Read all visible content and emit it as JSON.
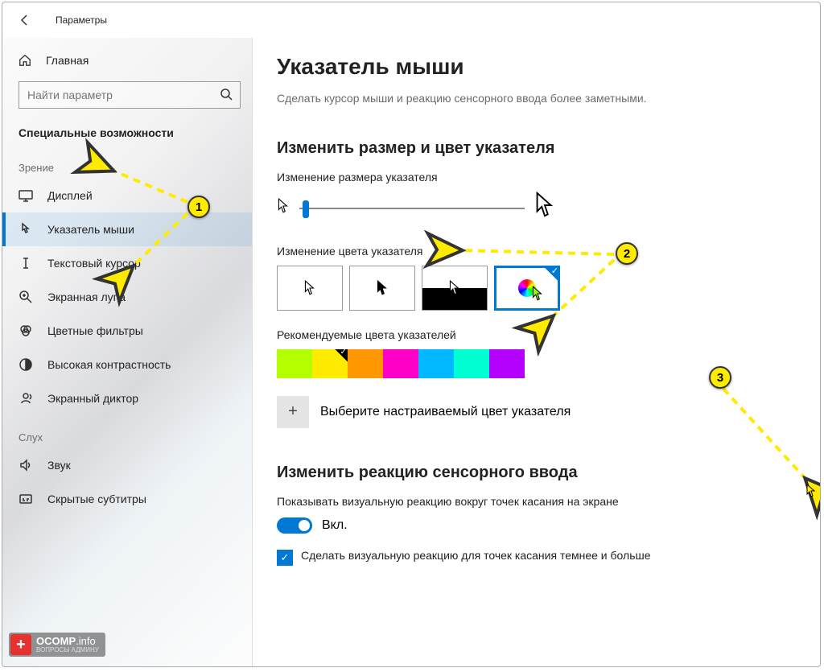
{
  "titlebar": {
    "title": "Параметры"
  },
  "sidebar": {
    "home": "Главная",
    "search_placeholder": "Найти параметр",
    "section": "Специальные возможности",
    "group_vision": "Зрение",
    "group_hearing": "Слух",
    "items_vision": [
      {
        "label": "Дисплей"
      },
      {
        "label": "Указатель мыши"
      },
      {
        "label": "Текстовый курсор"
      },
      {
        "label": "Экранная лупа"
      },
      {
        "label": "Цветные фильтры"
      },
      {
        "label": "Высокая контрастность"
      },
      {
        "label": "Экранный диктор"
      }
    ],
    "items_hearing": [
      {
        "label": "Звук"
      },
      {
        "label": "Скрытые субтитры"
      }
    ]
  },
  "main": {
    "h1": "Указатель мыши",
    "desc": "Сделать курсор мыши и реакцию сенсорного ввода более заметными.",
    "section1": "Изменить размер и цвет указателя",
    "size_label": "Изменение размера указателя",
    "color_label": "Изменение цвета указателя",
    "rec_label": "Рекомендуемые цвета указателей",
    "custom_label": "Выберите настраиваемый цвет указателя",
    "section2": "Изменить реакцию сенсорного ввода",
    "touch_desc": "Показывать визуальную реакцию вокруг точек касания на экране",
    "toggle_on": "Вкл.",
    "check_label": "Сделать визуальную реакцию для точек касания темнее и больше"
  },
  "colors": {
    "recommended": [
      "#b3ff00",
      "#ffeb00",
      "#ff9800",
      "#ff00c8",
      "#00b8ff",
      "#00ffd0",
      "#b400ff"
    ],
    "selected_index": 1
  },
  "annotations": {
    "n1": "1",
    "n2": "2",
    "n3": "3"
  },
  "logo": {
    "name": "OCOMP",
    "suffix": ".info",
    "sub": "ВОПРОСЫ АДМИНУ"
  }
}
